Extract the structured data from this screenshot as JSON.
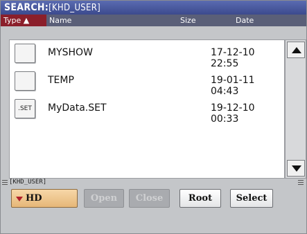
{
  "title": {
    "label": "SEARCH:",
    "path": "[KHD_USER]"
  },
  "columns": {
    "type": "Type ▲",
    "name": "Name",
    "size": "Size",
    "date": "Date"
  },
  "files": [
    {
      "icon": "folder-icon",
      "icon_text": "",
      "name": "MYSHOW",
      "date": "17-12-10 22:55"
    },
    {
      "icon": "folder-icon",
      "icon_text": "",
      "name": "TEMP",
      "date": "19-01-11 04:43"
    },
    {
      "icon": "set-file-icon",
      "icon_text": ".SET",
      "name": "MyData.SET",
      "date": "19-12-10 00:33"
    }
  ],
  "path_bar": "[KHD_USER]",
  "drive": {
    "label": "HD"
  },
  "buttons": {
    "open": "Open",
    "close": "Close",
    "root": "Root",
    "select": "Select"
  }
}
